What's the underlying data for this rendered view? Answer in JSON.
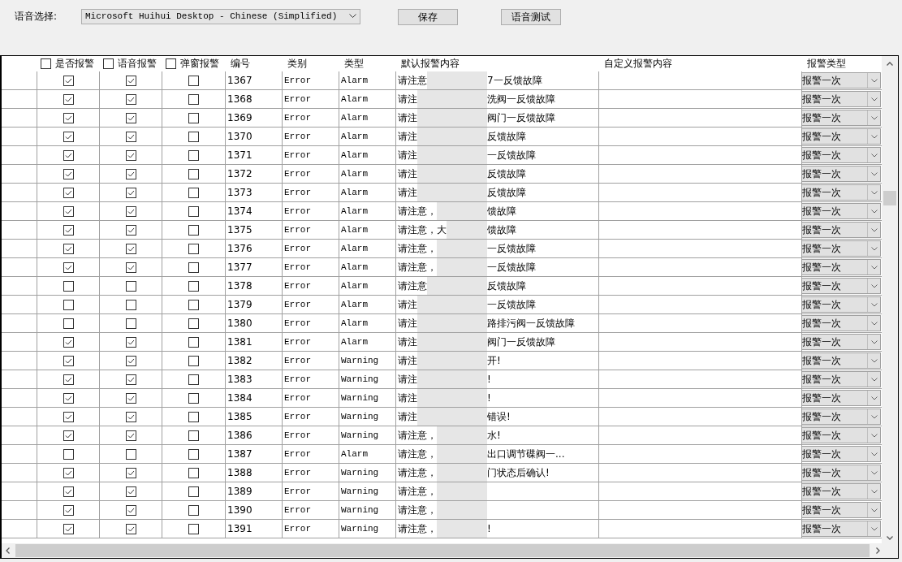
{
  "toolbar": {
    "voice_label": "语音选择:",
    "voice_select": "Microsoft Huihui Desktop - Chinese (Simplified)",
    "buttons": [
      "保存",
      "语音测试"
    ]
  },
  "table": {
    "columns": [
      {
        "label": "是否报警",
        "kind": "checkbox",
        "checked": false
      },
      {
        "label": "语音报警",
        "kind": "checkbox",
        "checked": false
      },
      {
        "label": "弹窗报警",
        "kind": "checkbox",
        "checked": false
      },
      {
        "label": "编号",
        "kind": "text"
      },
      {
        "label": "类别",
        "kind": "text"
      },
      {
        "label": "类型",
        "kind": "text"
      },
      {
        "label": "默认报警内容",
        "kind": "content"
      },
      {
        "label": "自定义报警内容",
        "kind": "text"
      },
      {
        "label": "报警类型",
        "kind": "dropdown"
      }
    ],
    "rows": [
      {
        "checks": [
          true,
          true,
          false
        ],
        "id": "1367",
        "category": "Error",
        "type": "Alarm",
        "content_start": "请注意",
        "content_end": "7一反馈故障",
        "alarm_type": "报警一次"
      },
      {
        "checks": [
          true,
          true,
          false
        ],
        "id": "1368",
        "category": "Error",
        "type": "Alarm",
        "content_start": "请注",
        "content_end": "洗阀一反馈故障",
        "alarm_type": "报警一次"
      },
      {
        "checks": [
          true,
          true,
          false
        ],
        "id": "1369",
        "category": "Error",
        "type": "Alarm",
        "content_start": "请注",
        "content_end": "阀门一反馈故障",
        "alarm_type": "报警一次"
      },
      {
        "checks": [
          true,
          true,
          false
        ],
        "id": "1370",
        "category": "Error",
        "type": "Alarm",
        "content_start": "请注",
        "content_end": "反馈故障",
        "alarm_type": "报警一次"
      },
      {
        "checks": [
          true,
          true,
          false
        ],
        "id": "1371",
        "category": "Error",
        "type": "Alarm",
        "content_start": "请注",
        "content_end": "一反馈故障",
        "alarm_type": "报警一次"
      },
      {
        "checks": [
          true,
          true,
          false
        ],
        "id": "1372",
        "category": "Error",
        "type": "Alarm",
        "content_start": "请注",
        "content_end": "反馈故障",
        "alarm_type": "报警一次"
      },
      {
        "checks": [
          true,
          true,
          false
        ],
        "id": "1373",
        "category": "Error",
        "type": "Alarm",
        "content_start": "请注",
        "content_end": "反馈故障",
        "alarm_type": "报警一次"
      },
      {
        "checks": [
          true,
          true,
          false
        ],
        "id": "1374",
        "category": "Error",
        "type": "Alarm",
        "content_start": "请注意，",
        "content_end": "馈故障",
        "alarm_type": "报警一次"
      },
      {
        "checks": [
          true,
          true,
          false
        ],
        "id": "1375",
        "category": "Error",
        "type": "Alarm",
        "content_start": "请注意，大",
        "content_end": "馈故障",
        "alarm_type": "报警一次"
      },
      {
        "checks": [
          true,
          true,
          false
        ],
        "id": "1376",
        "category": "Error",
        "type": "Alarm",
        "content_start": "请注意，",
        "content_end": "一反馈故障",
        "alarm_type": "报警一次"
      },
      {
        "checks": [
          true,
          true,
          false
        ],
        "id": "1377",
        "category": "Error",
        "type": "Alarm",
        "content_start": "请注意，",
        "content_end": "一反馈故障",
        "alarm_type": "报警一次"
      },
      {
        "checks": [
          false,
          false,
          false
        ],
        "id": "1378",
        "category": "Error",
        "type": "Alarm",
        "content_start": "请注意",
        "content_end": "反馈故障",
        "alarm_type": "报警一次"
      },
      {
        "checks": [
          false,
          false,
          false
        ],
        "id": "1379",
        "category": "Error",
        "type": "Alarm",
        "content_start": "请注",
        "content_end": "一反馈故障",
        "alarm_type": "报警一次"
      },
      {
        "checks": [
          false,
          false,
          false
        ],
        "id": "1380",
        "category": "Error",
        "type": "Alarm",
        "content_start": "请注",
        "content_end": "路排污阀一反馈故障",
        "alarm_type": "报警一次"
      },
      {
        "checks": [
          true,
          true,
          false
        ],
        "id": "1381",
        "category": "Error",
        "type": "Alarm",
        "content_start": "请注",
        "content_end": "阀门一反馈故障",
        "alarm_type": "报警一次"
      },
      {
        "checks": [
          true,
          true,
          false
        ],
        "id": "1382",
        "category": "Error",
        "type": "Warning",
        "content_start": "请注",
        "content_end": "开!",
        "alarm_type": "报警一次"
      },
      {
        "checks": [
          true,
          true,
          false
        ],
        "id": "1383",
        "category": "Error",
        "type": "Warning",
        "content_start": "请注",
        "content_end": "!",
        "alarm_type": "报警一次"
      },
      {
        "checks": [
          true,
          true,
          false
        ],
        "id": "1384",
        "category": "Error",
        "type": "Warning",
        "content_start": "请注",
        "content_end": "!",
        "alarm_type": "报警一次"
      },
      {
        "checks": [
          true,
          true,
          false
        ],
        "id": "1385",
        "category": "Error",
        "type": "Warning",
        "content_start": "请注",
        "content_end": "错误!",
        "alarm_type": "报警一次"
      },
      {
        "checks": [
          true,
          true,
          false
        ],
        "id": "1386",
        "category": "Error",
        "type": "Warning",
        "content_start": "请注意，",
        "content_end": "水!",
        "alarm_type": "报警一次"
      },
      {
        "checks": [
          false,
          false,
          false
        ],
        "id": "1387",
        "category": "Error",
        "type": "Alarm",
        "content_start": "请注意，",
        "content_end": "出口调节碟阀一...",
        "alarm_type": "报警一次"
      },
      {
        "checks": [
          true,
          true,
          false
        ],
        "id": "1388",
        "category": "Error",
        "type": "Warning",
        "content_start": "请注意，",
        "content_end": "门状态后确认!",
        "alarm_type": "报警一次"
      },
      {
        "checks": [
          true,
          true,
          false
        ],
        "id": "1389",
        "category": "Error",
        "type": "Warning",
        "content_start": "请注意，",
        "alarm_type": "报警一次"
      },
      {
        "checks": [
          true,
          true,
          false
        ],
        "id": "1390",
        "category": "Error",
        "type": "Warning",
        "content_start": "请注意，",
        "alarm_type": "报警一次"
      },
      {
        "checks": [
          true,
          true,
          false
        ],
        "id": "1391",
        "category": "Error",
        "type": "Warning",
        "content_start": "请注意，",
        "content_end": "!",
        "alarm_type": "报警一次"
      }
    ]
  }
}
